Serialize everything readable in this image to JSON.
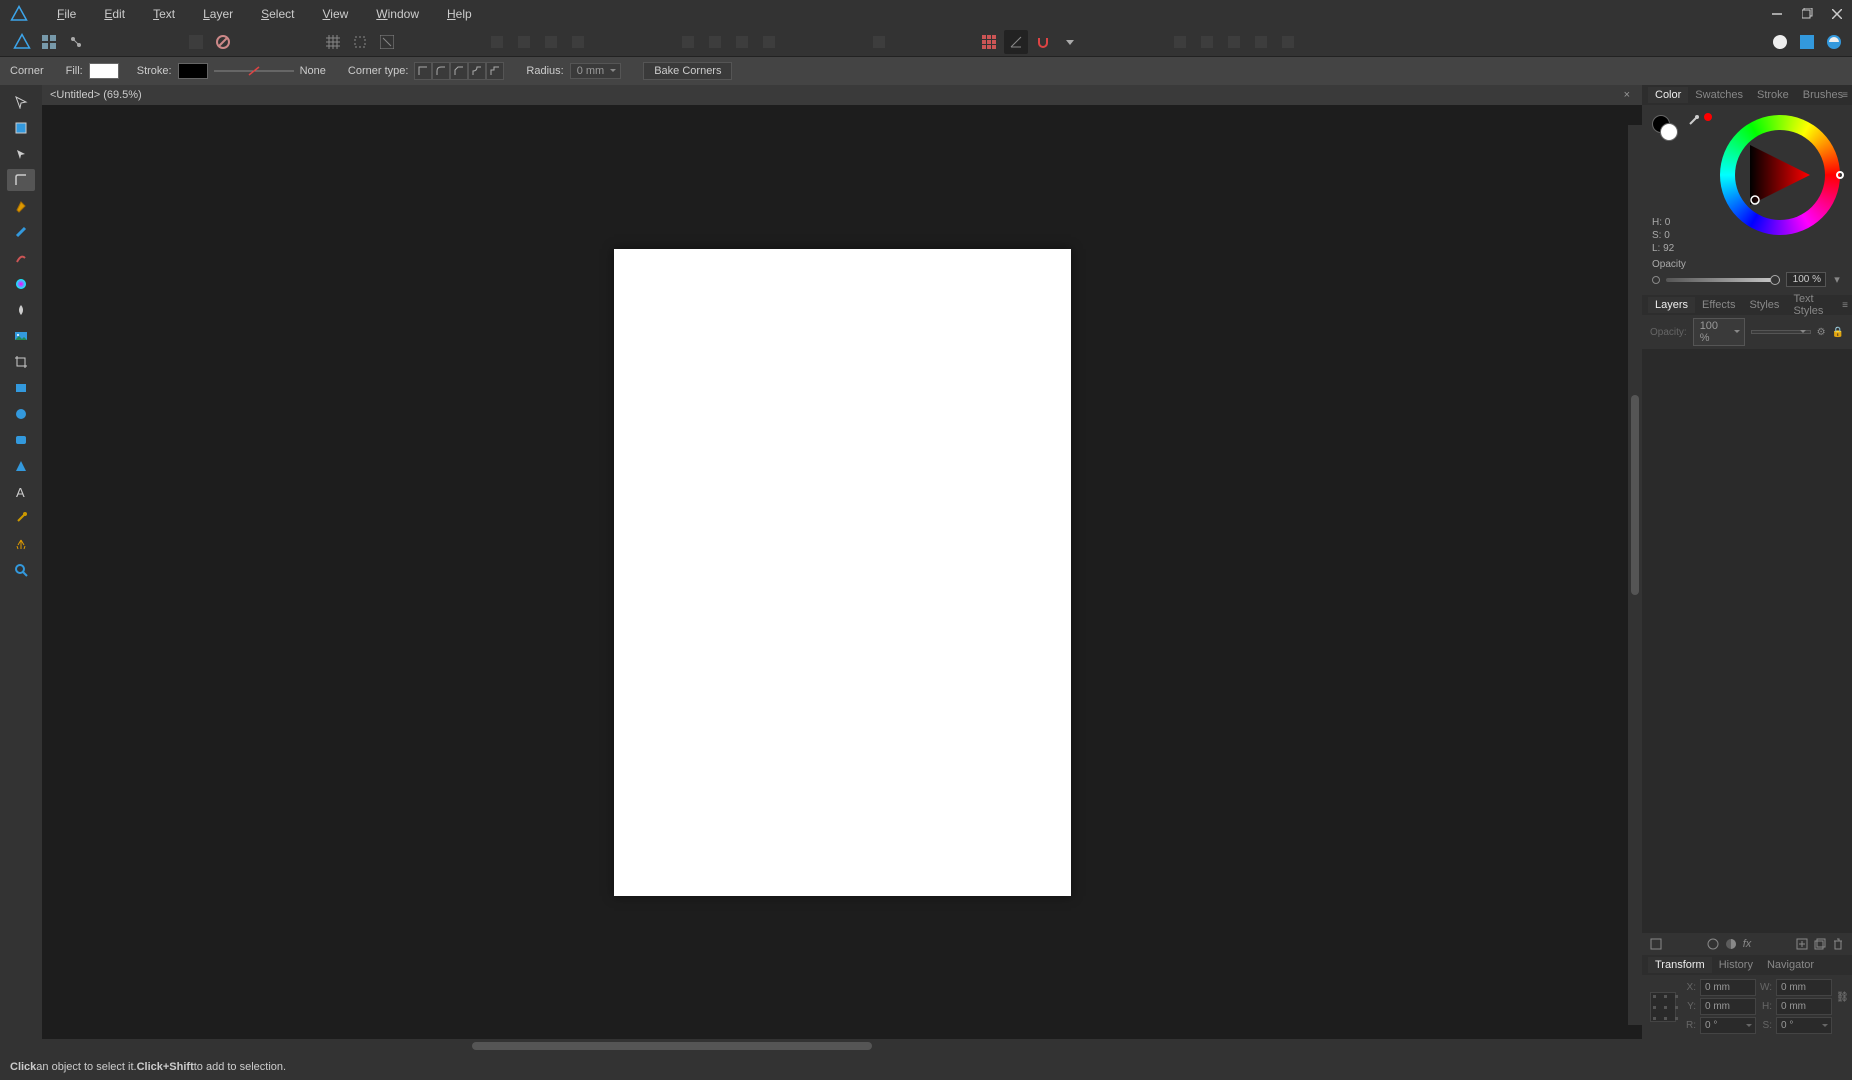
{
  "menu": {
    "file": "File",
    "edit": "Edit",
    "text": "Text",
    "layer": "Layer",
    "select": "Select",
    "view": "View",
    "window": "Window",
    "help": "Help"
  },
  "context_toolbar": {
    "corner_label": "Corner",
    "fill_label": "Fill:",
    "stroke_label": "Stroke:",
    "stroke_width": "None",
    "corner_type_label": "Corner type:",
    "radius_label": "Radius:",
    "radius_value": "0 mm",
    "bake": "Bake Corners"
  },
  "document": {
    "tab_title": "<Untitled> (69.5%)"
  },
  "panels": {
    "color_tabs": {
      "color": "Color",
      "swatches": "Swatches",
      "stroke": "Stroke",
      "brushes": "Brushes"
    },
    "color": {
      "h": "H: 0",
      "s": "S: 0",
      "l": "L: 92",
      "opacity_label": "Opacity",
      "opacity_value": "100 %"
    },
    "layers_tabs": {
      "layers": "Layers",
      "effects": "Effects",
      "styles": "Styles",
      "text_styles": "Text Styles"
    },
    "layers": {
      "opacity_label": "Opacity:",
      "opacity_value": "100 %"
    },
    "transform_tabs": {
      "transform": "Transform",
      "history": "History",
      "navigator": "Navigator"
    },
    "transform": {
      "x_label": "X:",
      "x_value": "0 mm",
      "y_label": "Y:",
      "y_value": "0 mm",
      "w_label": "W:",
      "w_value": "0 mm",
      "h_label": "H:",
      "h_value": "0 mm",
      "r_label": "R:",
      "r_value": "0 °",
      "s_label": "S:",
      "s_value": "0 °"
    }
  },
  "statusbar": {
    "click": "Click",
    "t1": " an object to select it. ",
    "clickshift": "Click+Shift",
    "t2": " to add to selection."
  },
  "colors": {
    "fill": "#ffffff",
    "stroke": "#000000"
  }
}
